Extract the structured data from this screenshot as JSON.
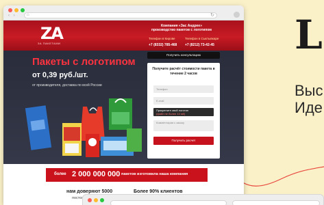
{
  "promo": {
    "big_letter": "L",
    "line1": "Выс",
    "line2": "Иде"
  },
  "browser": {
    "nav_arrows": "‹ ›",
    "url_icon": "⌂",
    "reload_icon": "↻"
  },
  "site": {
    "logo_text": "ZA",
    "logo_sub": "ЗА ПАКЕТАМИ",
    "company_line1": "Компания «Зас Андрее»",
    "company_line2": "производство пакетов с логотипом",
    "phone_label1": "Телефон в Кирове",
    "phone_label2": "Телефон в Сыктывкаре",
    "phone1": "+7 (8332) 785-468",
    "phone2": "+7 (8212) 73-42-45",
    "headline": "Пакеты с логотипом",
    "price": "от 0,39 руб./шт.",
    "subtitle": "от производителя, доставка по всей России",
    "consult_button": "Получить консультацию",
    "form": {
      "title": "Получите расчёт стоимости пакета в течение 2 часов",
      "phone_placeholder": "Телефон",
      "email_placeholder": "E-mail",
      "attach_label": "Прикрепите свой логотип",
      "attach_hint": "(файл не более 10 мб)",
      "comment_placeholder": "Комментарии к заказу",
      "submit": "Получить расчет"
    },
    "band": {
      "pre": "более",
      "big": "2 000 000 000",
      "post": "пакетов изготовила наша компания"
    },
    "trust1": "нам доверяют 5000",
    "trust1b": "постоянных клиентов",
    "trust2": "Более 90% клиентов"
  },
  "colors": {
    "brand_red": "#c9121c",
    "hero_dark": "#2a2d3b",
    "headline_red": "#ff3340",
    "page_bg": "#fbf1c9"
  }
}
